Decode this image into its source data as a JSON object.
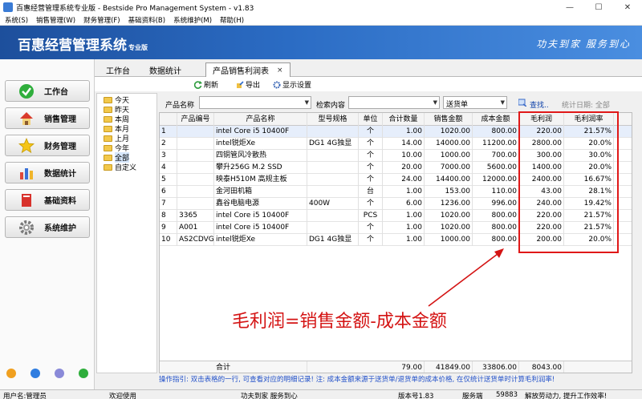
{
  "window": {
    "title": "百惠经营管理系统专业版 - Bestside Pro Management System - v1.83",
    "minimize": "—",
    "maximize": "☐",
    "close": "✕"
  },
  "menu": [
    "系统(S)",
    "销售管理(W)",
    "财务管理(F)",
    "基础资料(B)",
    "系统维护(M)",
    "帮助(H)"
  ],
  "banner": {
    "brand": "百惠经营管理系统",
    "edition": "专业版",
    "slogan": "功夫到家 服务到心"
  },
  "sidebar": {
    "items": [
      {
        "label": "工作台",
        "icon": "check-icon"
      },
      {
        "label": "销售管理",
        "icon": "house-icon"
      },
      {
        "label": "财务管理",
        "icon": "star-icon"
      },
      {
        "label": "数据统计",
        "icon": "bar-chart-icon"
      },
      {
        "label": "基础资料",
        "icon": "book-icon"
      },
      {
        "label": "系统维护",
        "icon": "gear-icon"
      }
    ]
  },
  "tabs": [
    {
      "label": "工作台"
    },
    {
      "label": "数据统计"
    },
    {
      "label": "产品销售利润表",
      "close": "×"
    }
  ],
  "toolbar": {
    "refresh": "刷新",
    "export": "导出",
    "display_settings": "显示设置"
  },
  "tree": {
    "nodes": [
      "今天",
      "昨天",
      "本周",
      "本月",
      "上月",
      "今年",
      "全部",
      "自定义"
    ],
    "selected": "全部"
  },
  "filter": {
    "product_name_label": "产品名称",
    "search_content_label": "检索内容",
    "doc_type": "送货单",
    "search_link": "查找..",
    "stat_date_label": "统计日期: 全部"
  },
  "table": {
    "headers": [
      "",
      "产品编号",
      "产品名称",
      "型号规格",
      "单位",
      "合计数量",
      "销售金额",
      "成本金额",
      "毛利润",
      "毛利润率"
    ],
    "rows": [
      [
        "1",
        "",
        "intel Core i5 10400F",
        "",
        "个",
        "1.00",
        "1020.00",
        "800.00",
        "220.00",
        "21.57%"
      ],
      [
        "2",
        "",
        "intel锐炬Xe",
        "DG1 4G独显",
        "个",
        "14.00",
        "14000.00",
        "11200.00",
        "2800.00",
        "20.0%"
      ],
      [
        "3",
        "",
        "四铜管风冷散热",
        "",
        "个",
        "10.00",
        "1000.00",
        "700.00",
        "300.00",
        "30.0%"
      ],
      [
        "4",
        "",
        "攀升256G M.2 SSD",
        "",
        "个",
        "20.00",
        "7000.00",
        "5600.00",
        "1400.00",
        "20.0%"
      ],
      [
        "5",
        "",
        "映泰H510M 高规主板",
        "",
        "个",
        "24.00",
        "14400.00",
        "12000.00",
        "2400.00",
        "16.67%"
      ],
      [
        "6",
        "",
        "金河田机箱",
        "",
        "台",
        "1.00",
        "153.00",
        "110.00",
        "43.00",
        "28.1%"
      ],
      [
        "7",
        "",
        "鑫谷电脑电源",
        "400W",
        "个",
        "6.00",
        "1236.00",
        "996.00",
        "240.00",
        "19.42%"
      ],
      [
        "8",
        "3365",
        "intel Core i5 10400F",
        "",
        "PCS",
        "1.00",
        "1020.00",
        "800.00",
        "220.00",
        "21.57%"
      ],
      [
        "9",
        "A001",
        "intel Core i5 10400F",
        "",
        "个",
        "1.00",
        "1020.00",
        "800.00",
        "220.00",
        "21.57%"
      ],
      [
        "10",
        "AS2CDVG",
        "intel锐炬Xe",
        "DG1 4G独显",
        "个",
        "1.00",
        "1000.00",
        "800.00",
        "200.00",
        "20.0%"
      ]
    ],
    "total": {
      "label": "合计",
      "qty": "79.00",
      "sales": "41849.00",
      "cost": "33806.00",
      "profit": "8043.00"
    }
  },
  "annotation": "毛利润=销售金额-成本金额",
  "hint": "操作指引: 双击表格的一行, 可查看对应的明细记录! 注: 成本金额来源于送货单/退货单的成本价格, 在仅统计送货单时计算毛利润率!",
  "status": {
    "user": "用户名:管理员",
    "welcome": "欢迎使用",
    "slogan": "功夫到家 服务到心",
    "version": "版本号1.83",
    "server": "服务端",
    "port": "59883",
    "motto": "解放劳动力, 提升工作效率!"
  },
  "colors": {
    "banner": "#2b6cc4",
    "annotation": "#d41313",
    "hint": "#2150c9"
  }
}
